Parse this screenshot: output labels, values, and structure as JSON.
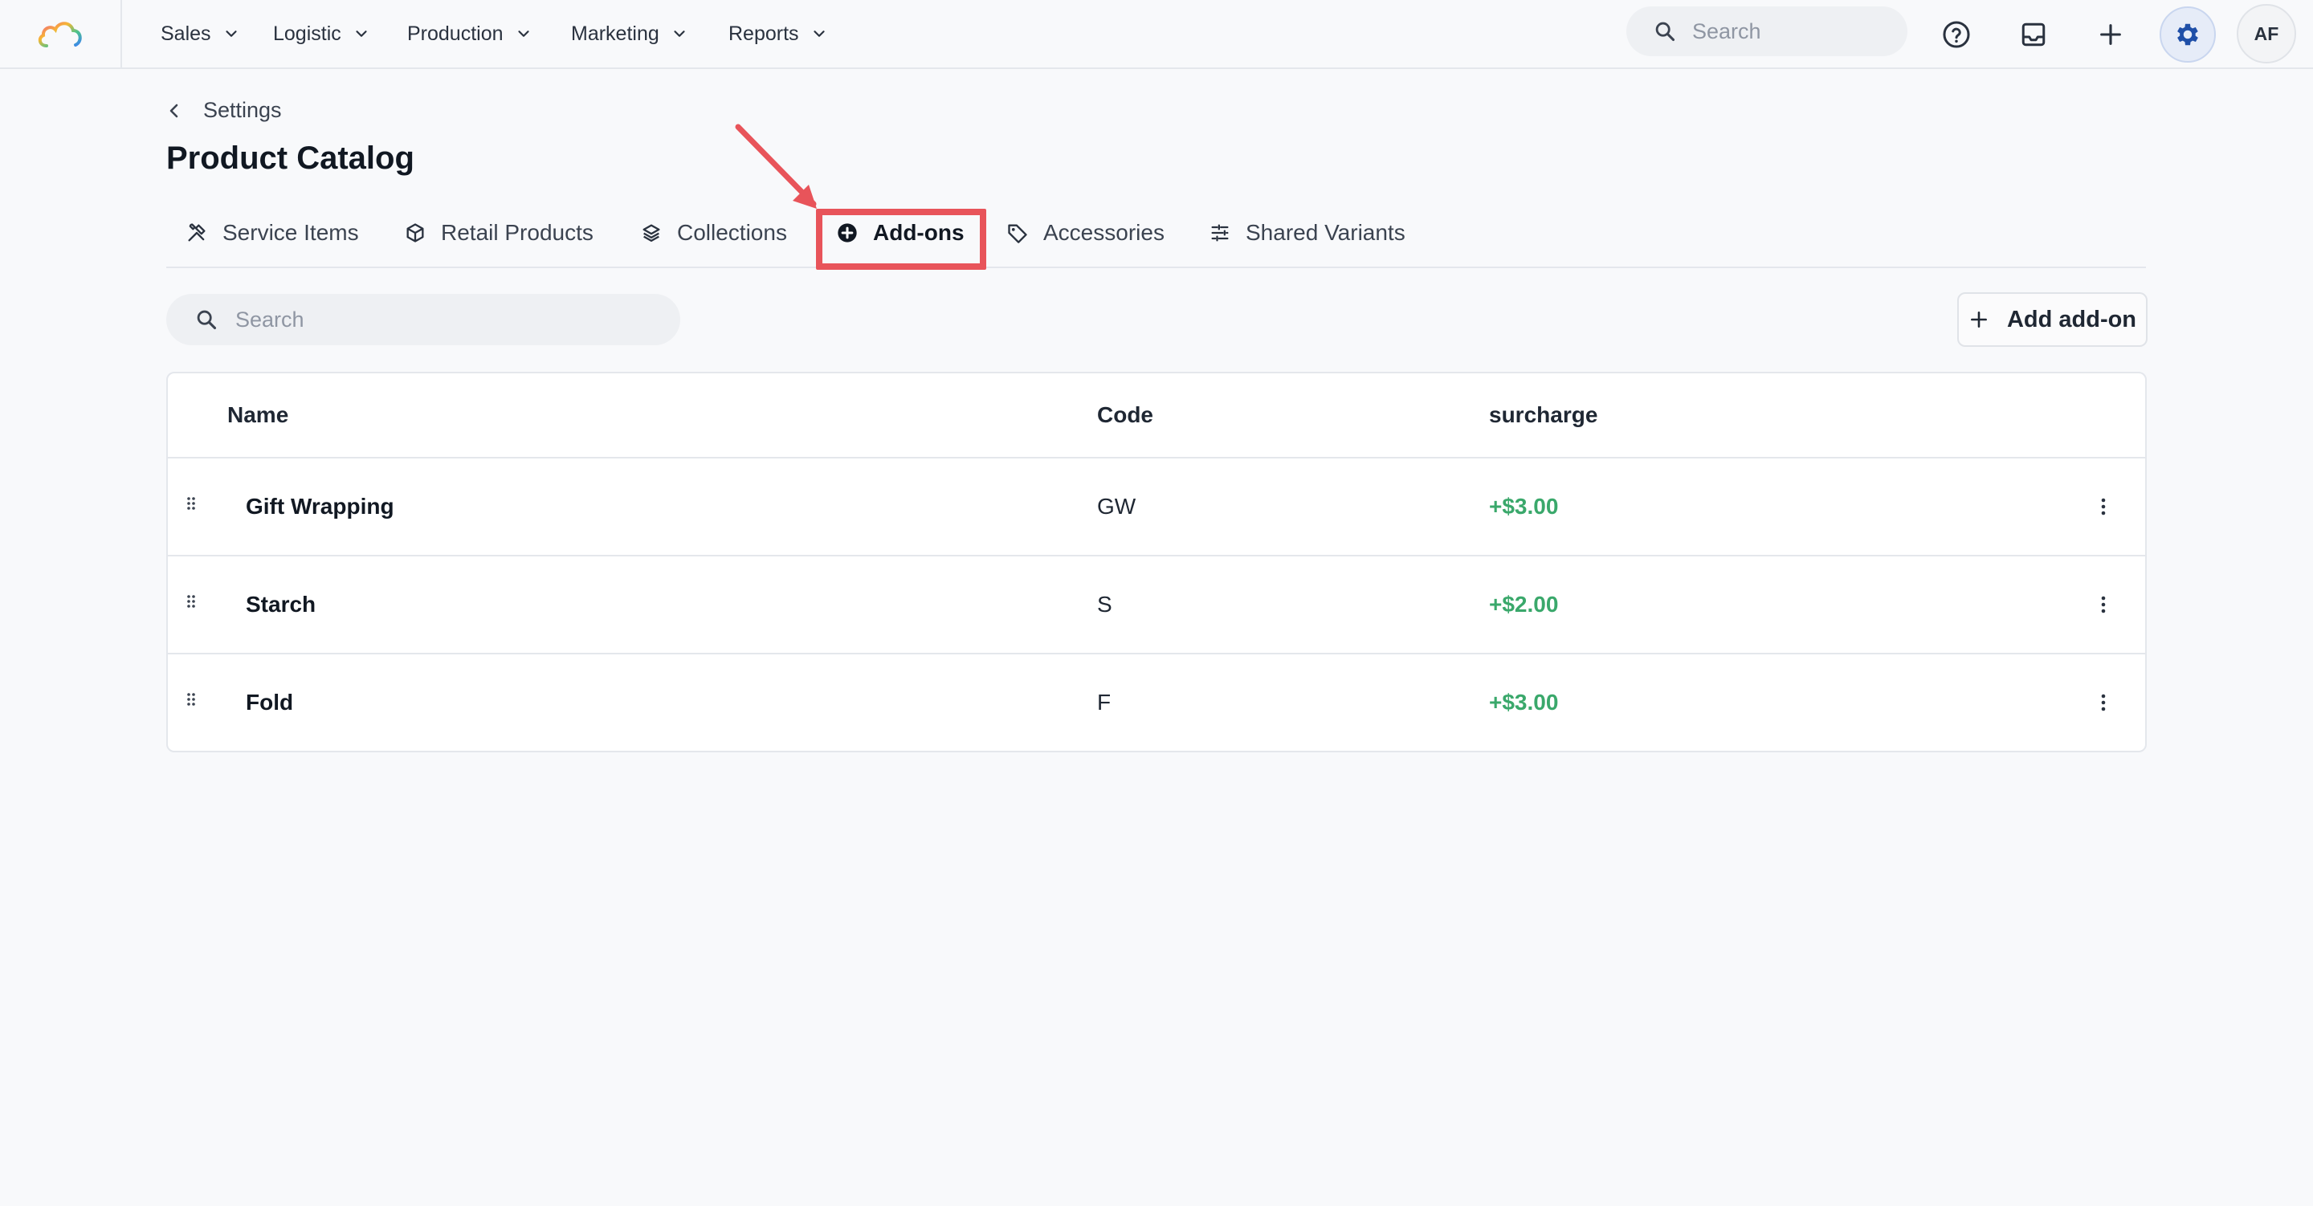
{
  "nav": {
    "items": [
      {
        "label": "Sales"
      },
      {
        "label": "Logistic"
      },
      {
        "label": "Production"
      },
      {
        "label": "Marketing"
      },
      {
        "label": "Reports"
      }
    ],
    "search_placeholder": "Search",
    "avatar_initials": "AF"
  },
  "page": {
    "breadcrumb": "Settings",
    "title": "Product Catalog"
  },
  "tabs": [
    {
      "label": "Service Items",
      "icon": "tools-icon"
    },
    {
      "label": "Retail Products",
      "icon": "box-icon"
    },
    {
      "label": "Collections",
      "icon": "layers-icon"
    },
    {
      "label": "Add-ons",
      "icon": "plus-circle-icon",
      "active": true
    },
    {
      "label": "Accessories",
      "icon": "tag-icon"
    },
    {
      "label": "Shared Variants",
      "icon": "sliders-icon"
    }
  ],
  "toolbar": {
    "search_placeholder": "Search",
    "add_label": "Add add-on"
  },
  "table": {
    "headers": {
      "name": "Name",
      "code": "Code",
      "surcharge": "surcharge"
    },
    "rows": [
      {
        "name": "Gift Wrapping",
        "code": "GW",
        "surcharge": "+$3.00"
      },
      {
        "name": "Starch",
        "code": "S",
        "surcharge": "+$2.00"
      },
      {
        "name": "Fold",
        "code": "F",
        "surcharge": "+$3.00"
      }
    ]
  },
  "colors": {
    "surcharge": "#3aa86b",
    "highlight": "#e8545a",
    "settings_active": "#1f4fa8"
  }
}
